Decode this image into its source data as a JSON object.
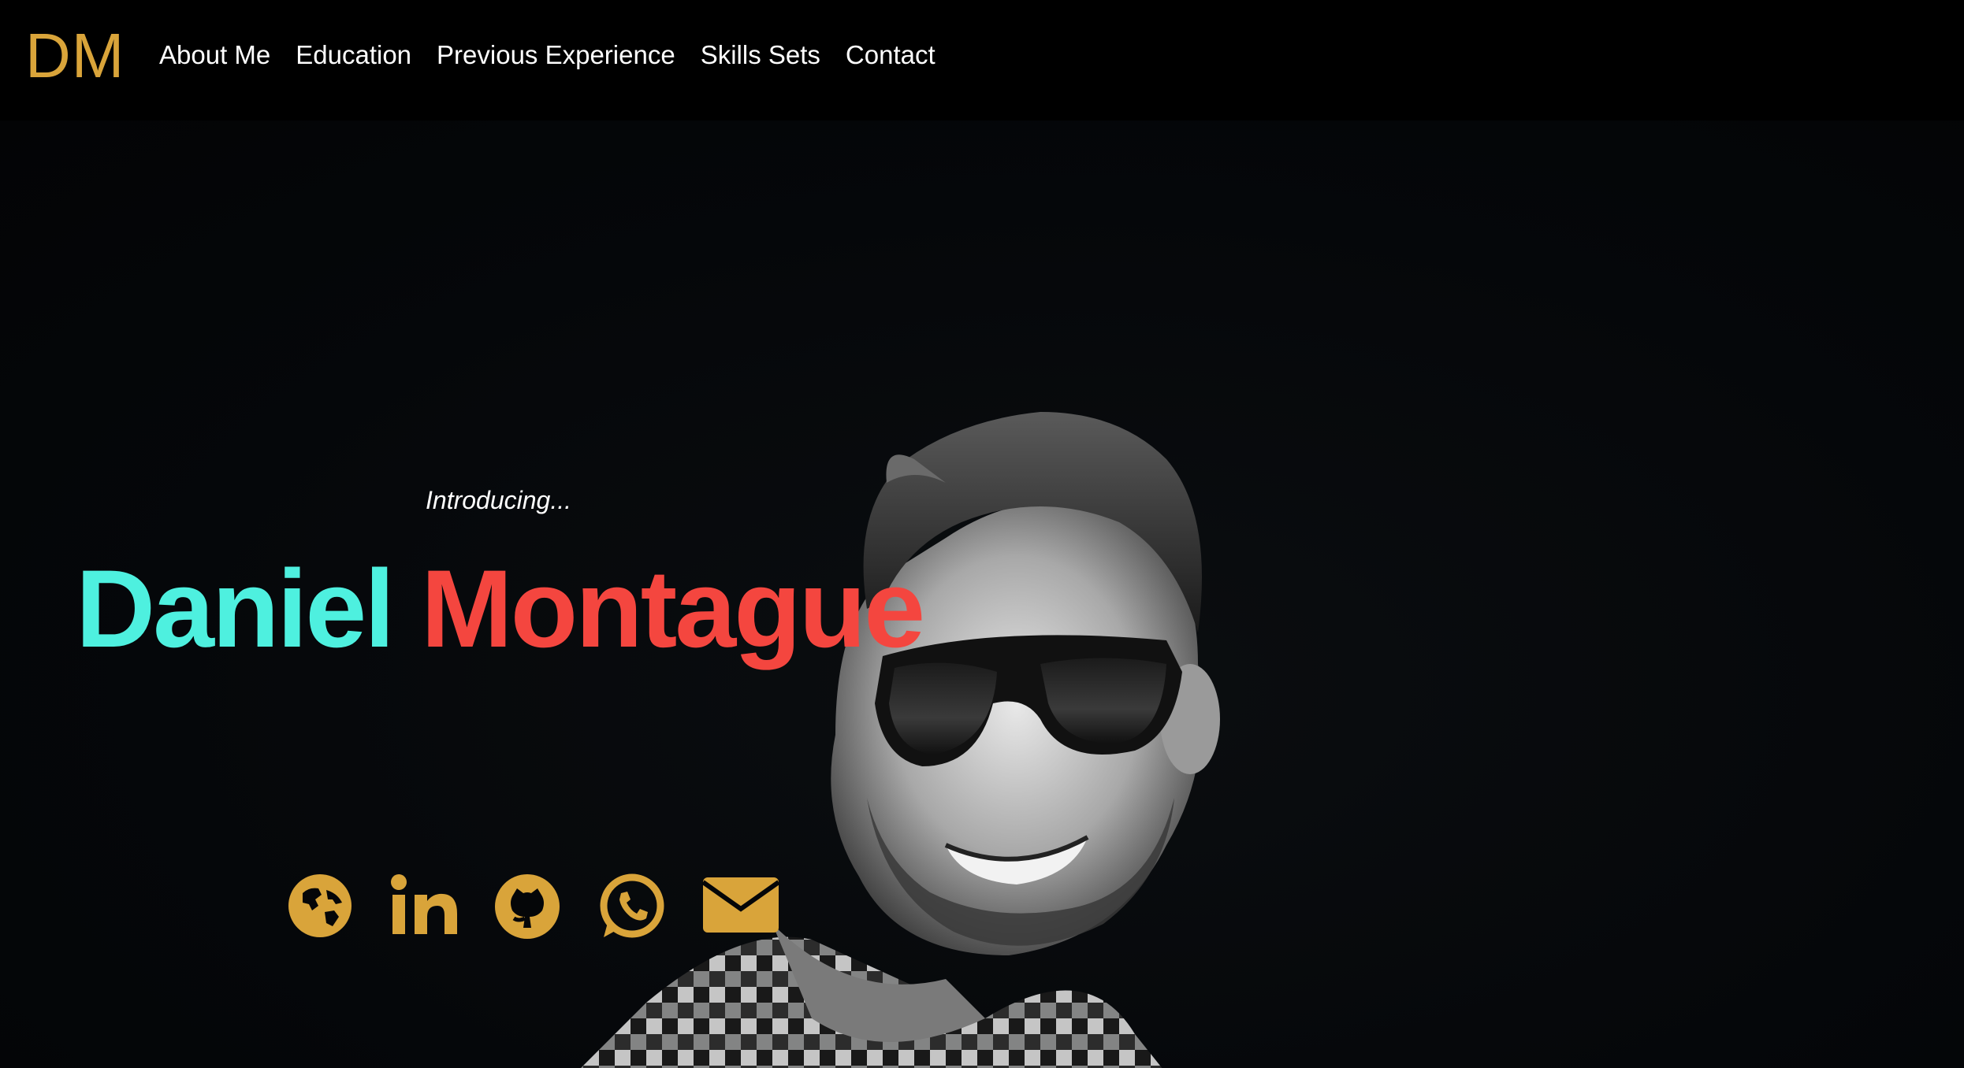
{
  "brand": {
    "logo_text": "DM",
    "color": "#d9a43a"
  },
  "nav": {
    "items": [
      {
        "label": "About Me"
      },
      {
        "label": "Education"
      },
      {
        "label": "Previous Experience"
      },
      {
        "label": "Skills Sets"
      },
      {
        "label": "Contact"
      }
    ]
  },
  "hero": {
    "intro": "Introducing...",
    "first_name": "Daniel",
    "last_name": "Montague",
    "first_name_color": "#4ef0df",
    "last_name_color": "#f4463f",
    "portrait": "black-and-white photo of smiling man with sunglasses",
    "socials": [
      {
        "icon": "globe-icon"
      },
      {
        "icon": "linkedin-icon"
      },
      {
        "icon": "github-icon"
      },
      {
        "icon": "whatsapp-icon"
      },
      {
        "icon": "email-icon"
      }
    ],
    "icon_color": "#d9a43a"
  }
}
